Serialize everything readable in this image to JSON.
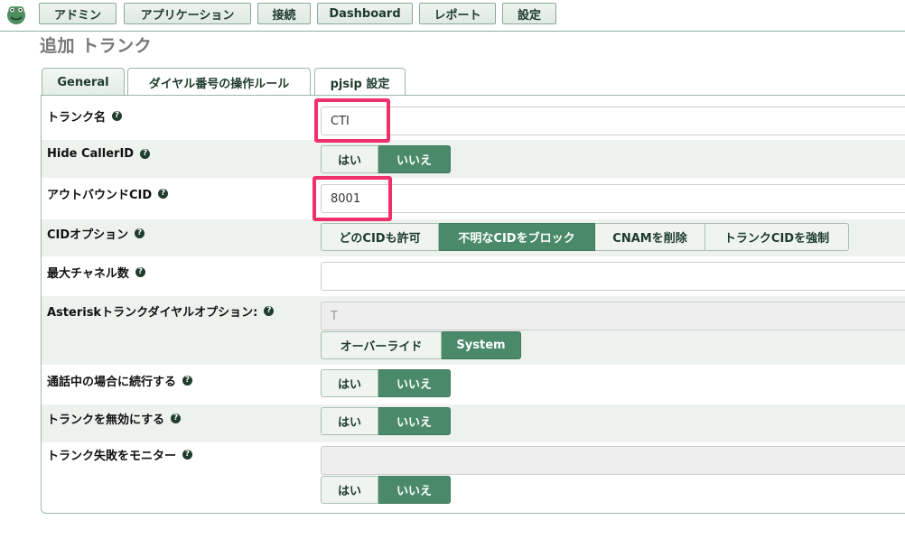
{
  "nav": [
    "アドミン",
    "アプリケーション",
    "接続",
    "Dashboard",
    "レポート",
    "設定"
  ],
  "page_title": "追加 トランク",
  "tabs": [
    "General",
    "ダイヤル番号の操作ルール",
    "pjsip 設定"
  ],
  "help_glyph": "?",
  "fields": {
    "trunk_name": {
      "label": "トランク名",
      "value": "CTI"
    },
    "hide_callerid": {
      "label": "Hide CallerID",
      "options": [
        "はい",
        "いいえ"
      ],
      "selected": "いいえ"
    },
    "outbound_cid": {
      "label": "アウトバウンドCID",
      "value": "8001"
    },
    "cid_options": {
      "label": "CIDオプション",
      "options": [
        "どのCIDも許可",
        "不明なCIDをブロック",
        "CNAMを削除",
        "トランクCIDを強制"
      ],
      "selected": "不明なCIDをブロック"
    },
    "max_channels": {
      "label": "最大チャネル数",
      "value": ""
    },
    "asterisk_dial_options": {
      "label": "Asteriskトランクダイヤルオプション:",
      "value": "T",
      "options": [
        "オーバーライド",
        "System"
      ],
      "selected": "System"
    },
    "continue_if_busy": {
      "label": "通話中の場合に続行する",
      "options": [
        "はい",
        "いいえ"
      ],
      "selected": "いいえ"
    },
    "disable_trunk": {
      "label": "トランクを無効にする",
      "options": [
        "はい",
        "いいえ"
      ],
      "selected": "いいえ"
    },
    "monitor_trunk_failures": {
      "label": "トランク失敗をモニター",
      "value": "",
      "options": [
        "はい",
        "いいえ"
      ],
      "selected": "いいえ"
    }
  },
  "colors": {
    "selected_button": "#4a8a6a",
    "highlight": "#f0306c",
    "border": "#9bb8a8"
  }
}
